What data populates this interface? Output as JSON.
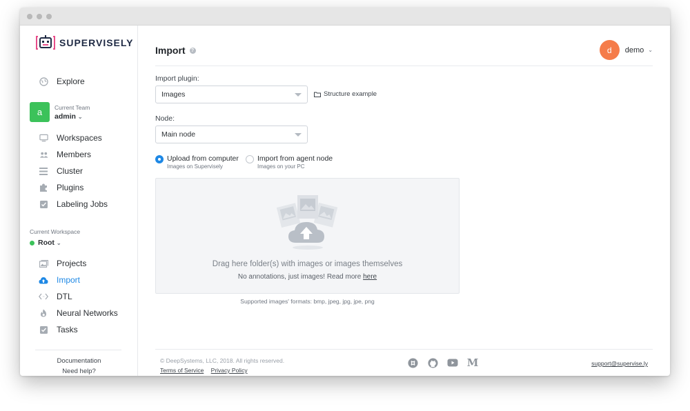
{
  "brand": {
    "name": "SUPERVISELY"
  },
  "sidebar": {
    "explore_label": "Explore",
    "team": {
      "caption": "Current Team",
      "name": "admin",
      "avatar_letter": "a",
      "avatar_color": "#3cc25a"
    },
    "team_items": [
      {
        "label": "Workspaces",
        "icon": "monitor-icon"
      },
      {
        "label": "Members",
        "icon": "users-icon"
      },
      {
        "label": "Cluster",
        "icon": "list-icon"
      },
      {
        "label": "Plugins",
        "icon": "puzzle-icon"
      },
      {
        "label": "Labeling Jobs",
        "icon": "checkbox-icon"
      }
    ],
    "workspace": {
      "caption": "Current Workspace",
      "name": "Root",
      "status_color": "#3cc25a"
    },
    "workspace_items": [
      {
        "label": "Projects",
        "icon": "images-icon"
      },
      {
        "label": "Import",
        "icon": "cloud-upload-icon",
        "active": true
      },
      {
        "label": "DTL",
        "icon": "code-icon"
      },
      {
        "label": "Neural Networks",
        "icon": "flame-icon"
      },
      {
        "label": "Tasks",
        "icon": "checkbox-icon"
      }
    ],
    "footer": {
      "documentation": "Documentation",
      "help": "Need help?"
    }
  },
  "header": {
    "title": "Import",
    "user": {
      "name": "demo",
      "avatar_letter": "d",
      "avatar_color": "#f57c4a"
    }
  },
  "form": {
    "plugin_label": "Import plugin:",
    "plugin_value": "Images",
    "structure_example": "Structure example",
    "node_label": "Node:",
    "node_value": "Main node",
    "sources": [
      {
        "title": "Upload from computer",
        "subtitle": "Images on Supervisely",
        "selected": true
      },
      {
        "title": "Import from agent node",
        "subtitle": "Images on your PC",
        "selected": false
      }
    ]
  },
  "dropzone": {
    "title": "Drag here folder(s) with images or images themselves",
    "subtitle_prefix": "No annotations, just images! Read more",
    "subtitle_link": "here",
    "formats": "Supported images' formats: bmp, jpeg, jpg, jpe, png"
  },
  "footer": {
    "copyright": "© DeepSystems, LLC, 2018. All rights reserved.",
    "terms": "Terms of Service",
    "privacy": "Privacy Policy",
    "social": [
      "slack-icon",
      "github-icon",
      "youtube-icon",
      "medium-icon"
    ],
    "support_email": "support@supervise.ly"
  },
  "colors": {
    "accent": "#1e88e5",
    "team_green": "#3cc25a",
    "user_orange": "#f57c4a"
  }
}
